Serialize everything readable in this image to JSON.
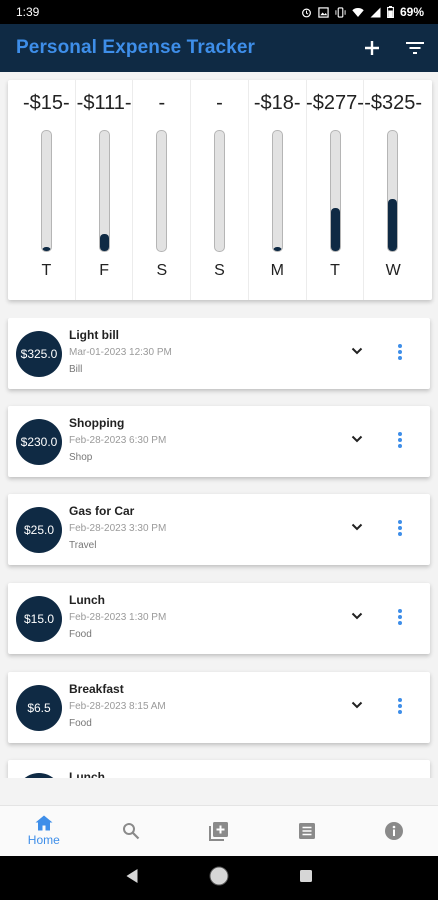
{
  "status_bar": {
    "time": "1:39",
    "battery": "69%"
  },
  "app_bar": {
    "title": "Personal Expense Tracker",
    "add_icon": "plus-icon",
    "filter_icon": "filter-icon"
  },
  "chart": {
    "days": [
      {
        "label": "T",
        "amount": "-$15-",
        "fill": 0.03
      },
      {
        "label": "F",
        "amount": "-$111-",
        "fill": 0.14
      },
      {
        "label": "S",
        "amount": "-",
        "fill": 0
      },
      {
        "label": "S",
        "amount": "-",
        "fill": 0
      },
      {
        "label": "M",
        "amount": "-$18-",
        "fill": 0.03
      },
      {
        "label": "T",
        "amount": "-$277-",
        "fill": 0.36
      },
      {
        "label": "W",
        "amount": "-$325-",
        "fill": 0.43
      }
    ]
  },
  "expenses": [
    {
      "amount": "$325.0",
      "title": "Light bill",
      "date": "Mar-01-2023  12:30 PM",
      "category": "Bill"
    },
    {
      "amount": "$230.0",
      "title": "Shopping",
      "date": "Feb-28-2023  6:30 PM",
      "category": "Shop"
    },
    {
      "amount": "$25.0",
      "title": "Gas for Car",
      "date": "Feb-28-2023  3:30 PM",
      "category": "Travel"
    },
    {
      "amount": "$15.0",
      "title": "Lunch",
      "date": "Feb-28-2023  1:30 PM",
      "category": "Food"
    },
    {
      "amount": "$6.5",
      "title": "Breakfast",
      "date": "Feb-28-2023  8:15 AM",
      "category": "Food"
    },
    {
      "amount": "",
      "title": "Lunch",
      "date": "",
      "category": ""
    }
  ],
  "bottom_nav": {
    "home_label": "Home",
    "items": [
      "home-icon",
      "search-icon",
      "add-box-icon",
      "list-icon",
      "info-icon"
    ]
  },
  "colors": {
    "primary": "#0f2a44",
    "accent": "#3e8ee9"
  }
}
